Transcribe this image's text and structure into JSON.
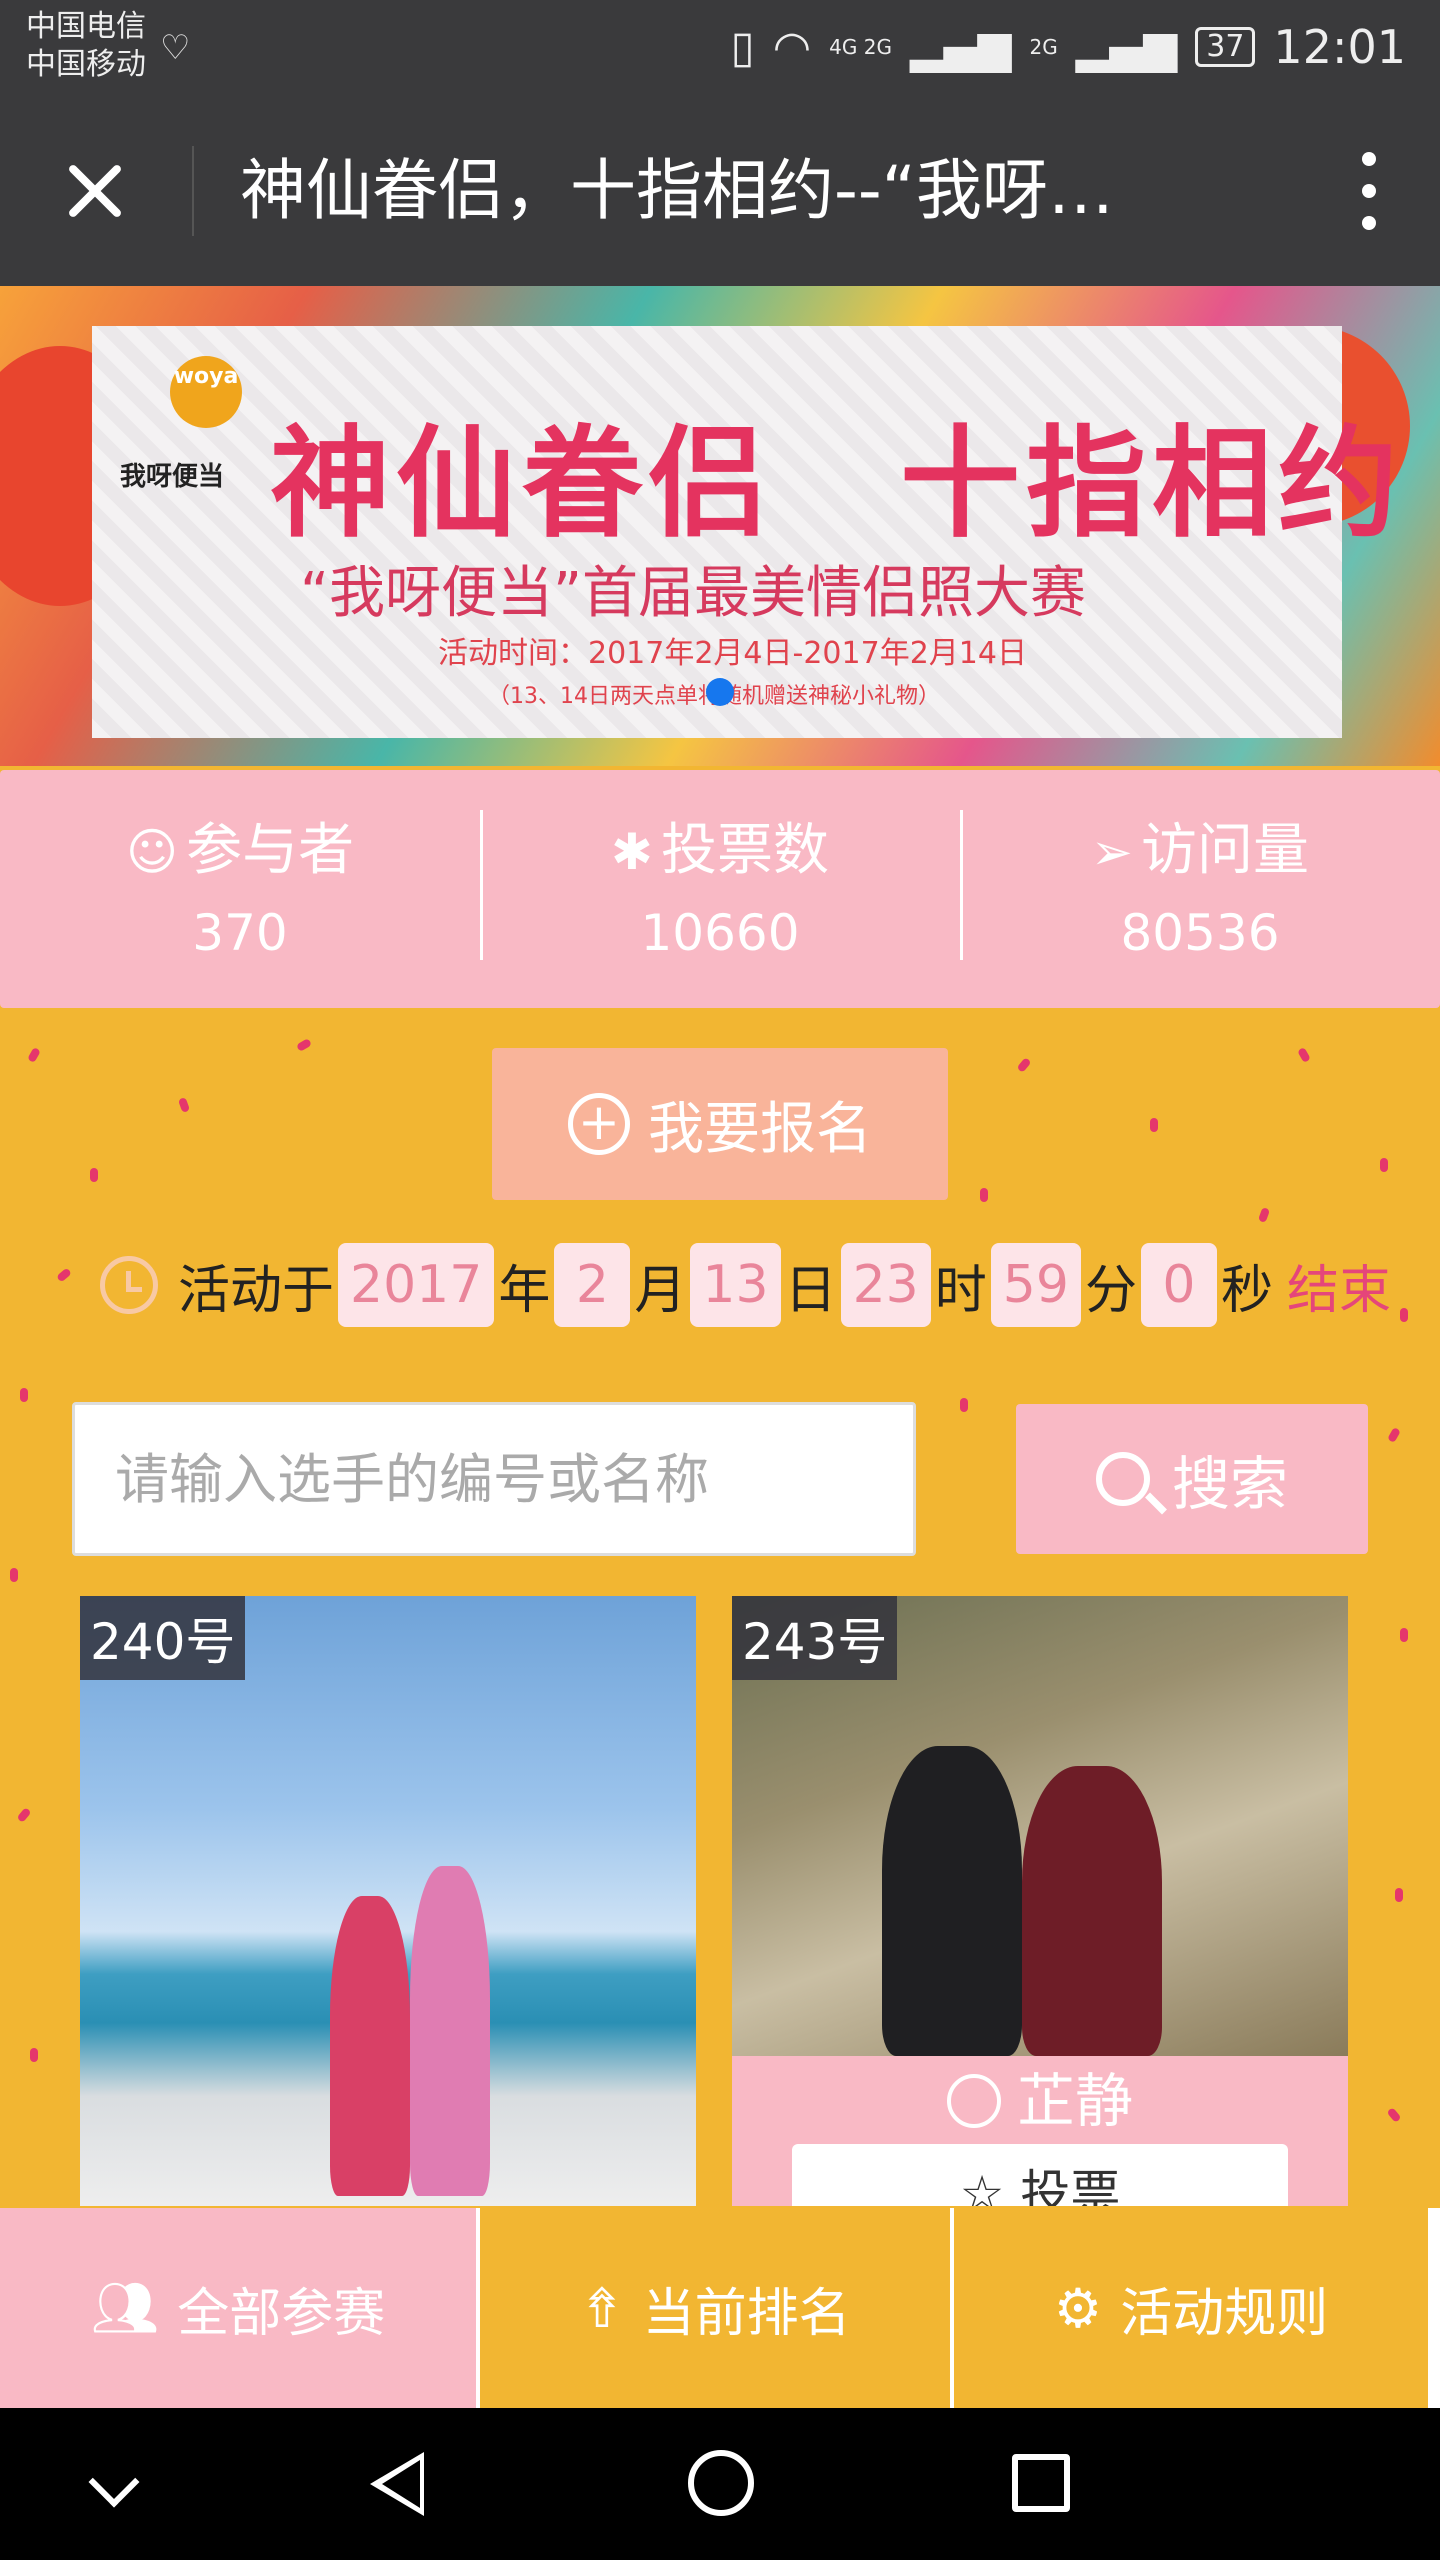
{
  "status_bar": {
    "carrier_1": "中国电信",
    "carrier_2": "中国移动",
    "network_1": "4G 2G",
    "network_2": "2G",
    "battery": "37",
    "time": "12:01"
  },
  "title_bar": {
    "title": "神仙眷侣，十指相约--“我呀…"
  },
  "banner": {
    "logo_text": "woya",
    "logo_brand": "我呀便当",
    "title": "神仙眷侣　十指相约",
    "subtitle": "“我呀便当”首届最美情侣照大赛",
    "date": "活动时间：2017年2月4日-2017年2月14日",
    "note": "（13、14日两天点单将随机赠送神秘小礼物）"
  },
  "stats": [
    {
      "icon": "smile-icon",
      "label": "参与者",
      "value": "370"
    },
    {
      "icon": "palm-tree-icon",
      "label": "投票数",
      "value": "10660"
    },
    {
      "icon": "paper-plane-icon",
      "label": "访问量",
      "value": "80536"
    }
  ],
  "signup": {
    "label": "我要报名"
  },
  "countdown": {
    "prefix": "活动于",
    "year": "2017",
    "year_unit": "年",
    "month": "2",
    "month_unit": "月",
    "day": "13",
    "day_unit": "日",
    "hour": "23",
    "hour_unit": "时",
    "minute": "59",
    "minute_unit": "分",
    "second": "0",
    "second_unit": "秒",
    "suffix": "结束"
  },
  "search": {
    "placeholder": "请输入选手的编号或名称",
    "button_label": "搜索"
  },
  "contestants": [
    {
      "number": "240号",
      "name": ""
    },
    {
      "number": "243号",
      "name": "芷静",
      "vote_label": "投票"
    }
  ],
  "tabs": [
    {
      "label": "全部参赛",
      "icon": "users-icon"
    },
    {
      "label": "当前排名",
      "icon": "rocket-top-icon"
    },
    {
      "label": "活动规则",
      "icon": "gear-icon"
    }
  ],
  "colors": {
    "background": "#f2b632",
    "pink": "#f9b9c5",
    "accent": "#e5467a",
    "dark": "#3a3a3c"
  }
}
